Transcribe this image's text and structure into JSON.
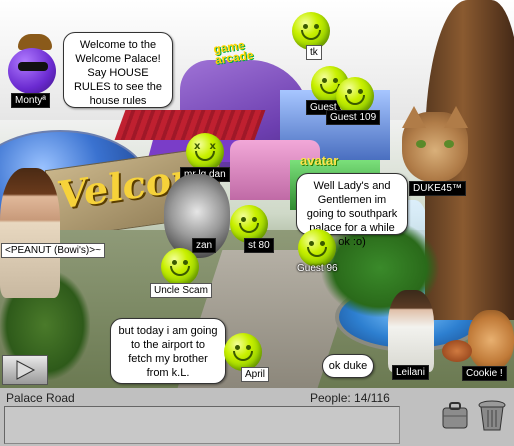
{
  "room": {
    "speech": {
      "monty": "Welcome to the Welcome Palace! Say HOUSE RULES to see the house rules",
      "duke": "Well Lady's and Gentlemen im going to southpark palace for a while ok :o)",
      "april": "but today i am going to the airport to fetch my brother from k.L.",
      "leilani": "ok duke"
    },
    "names": {
      "monty": "Montyª",
      "tk": "tk",
      "guest67": "Guest 67",
      "guest109": "Guest 109",
      "mrlgdan": "mr lg dan",
      "duke": "DUKE45™",
      "peanut": "<PEANUT (Bowi's)>~",
      "zan": "zan",
      "guest80": "st 80",
      "guest96": "Guest 96",
      "uncle": "Uncle Scam",
      "april": "April",
      "leilani": "Leilani",
      "cookie": "Cookie  !"
    },
    "signs": {
      "welcome": "Velcom",
      "game": "game arcade",
      "avatar": "avatar"
    }
  },
  "status": {
    "room_name": "Palace Road",
    "people": "People: 14/116"
  },
  "icons": {
    "play": "play-icon",
    "briefcase": "briefcase-icon",
    "trash": "trash-icon"
  }
}
